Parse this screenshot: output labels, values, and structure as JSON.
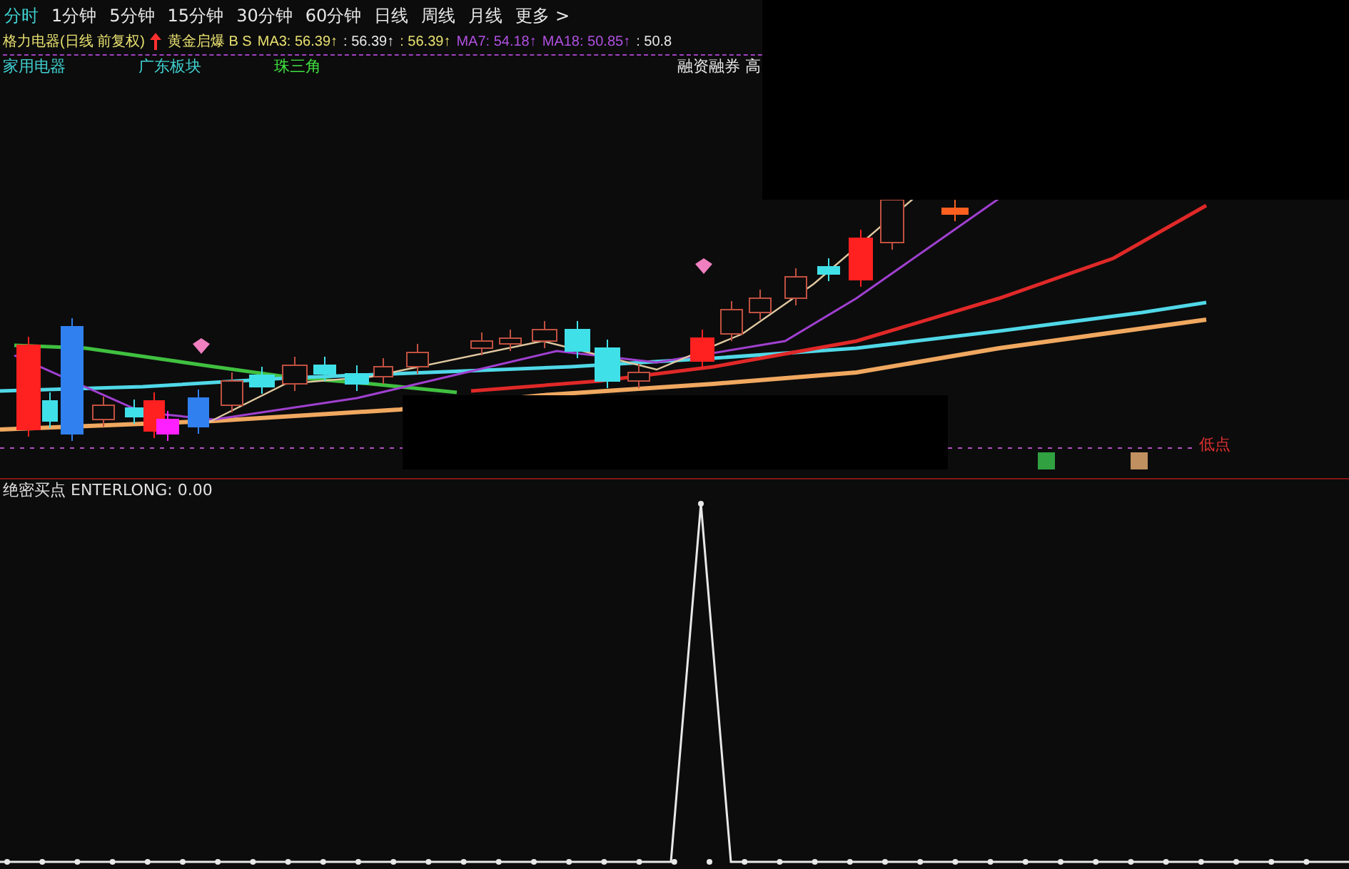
{
  "period_tabs": [
    {
      "label": "分时",
      "selected": true
    },
    {
      "label": "1分钟",
      "selected": false
    },
    {
      "label": "5分钟",
      "selected": false
    },
    {
      "label": "15分钟",
      "selected": false
    },
    {
      "label": "30分钟",
      "selected": false
    },
    {
      "label": "60分钟",
      "selected": false
    },
    {
      "label": "日线",
      "selected": false
    },
    {
      "label": "周线",
      "selected": false
    },
    {
      "label": "月线",
      "selected": false
    },
    {
      "label": "更多 >",
      "selected": false
    }
  ],
  "legend": {
    "title": "格力电器(日线 前复权)",
    "signal": "黄金启爆 B S",
    "values": [
      {
        "text": "MA3: 56.39↑",
        "color": "#e8e070"
      },
      {
        "text": ": 56.39↑",
        "color": "#e8e8e8"
      },
      {
        "text": ": 56.39↑",
        "color": "#e8e070"
      },
      {
        "text": "MA7: 54.18↑",
        "color": "#b050e0"
      },
      {
        "text": "MA18: 50.85↑",
        "color": "#b050e0"
      },
      {
        "text": ": 50.8",
        "color": "#e8e8e8"
      }
    ]
  },
  "sectors": [
    {
      "text": "家用电器",
      "color": "#40d0d0"
    },
    {
      "text": "广东板块",
      "color": "#40d0d0"
    },
    {
      "text": "珠三角",
      "color": "#40e040"
    }
  ],
  "margin_label": "融资融券 高",
  "low_point_label": "低点",
  "indicator": {
    "label": "绝密买点 ENTERLONG: 0.00"
  }
}
